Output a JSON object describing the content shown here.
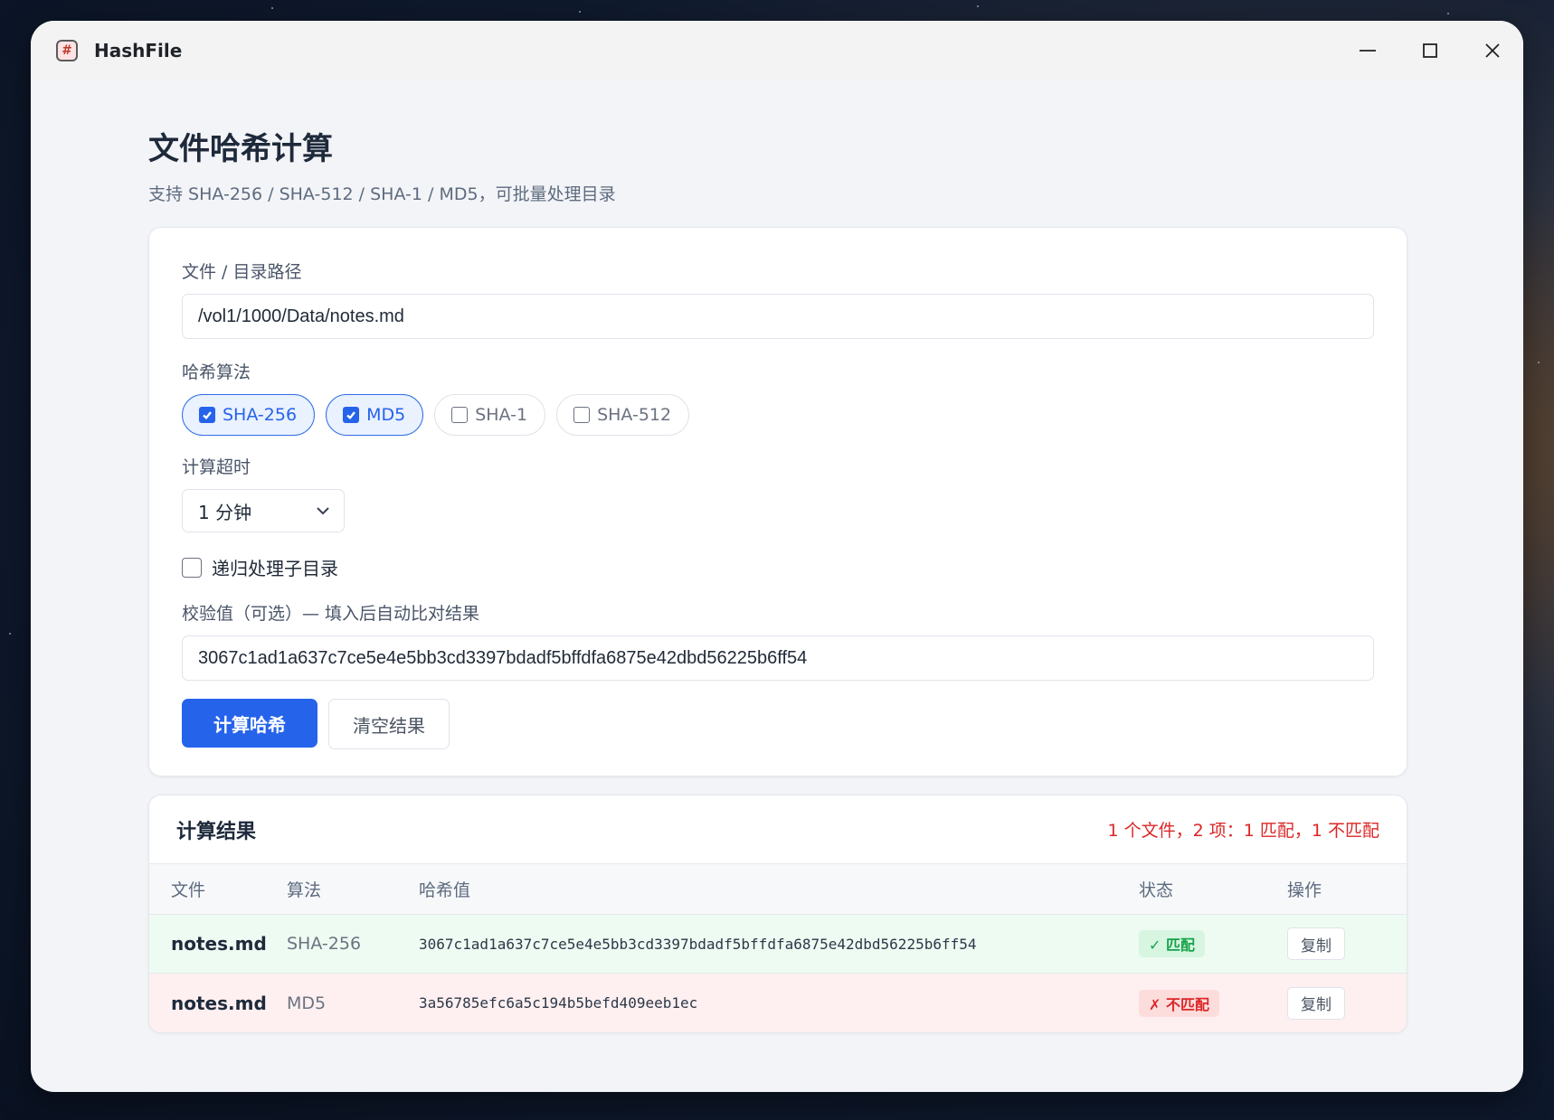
{
  "window": {
    "title": "HashFile",
    "icon": "hash-grid-icon"
  },
  "header": {
    "title": "文件哈希计算",
    "subtitle": "支持 SHA-256 / SHA-512 / SHA-1 / MD5，可批量处理目录"
  },
  "form": {
    "path_label": "文件 / 目录路径",
    "path_value": "/vol1/1000/Data/notes.md",
    "algo_label": "哈希算法",
    "algorithms": [
      {
        "label": "SHA-256",
        "checked": true
      },
      {
        "label": "MD5",
        "checked": true
      },
      {
        "label": "SHA-1",
        "checked": false
      },
      {
        "label": "SHA-512",
        "checked": false
      }
    ],
    "timeout_label": "计算超时",
    "timeout_value": "1 分钟",
    "recurse_label": "递归处理子目录",
    "recurse_checked": false,
    "checksum_label": "校验值（可选）— 填入后自动比对结果",
    "checksum_value": "3067c1ad1a637c7ce5e4e5bb3cd3397bdadf5bffdfa6875e42dbd56225b6ff54",
    "compute_label": "计算哈希",
    "clear_label": "清空结果"
  },
  "results": {
    "title": "计算结果",
    "summary": "1 个文件，2 项：1 匹配，1 不匹配",
    "columns": [
      "文件",
      "算法",
      "哈希值",
      "状态",
      "操作"
    ],
    "rows": [
      {
        "file": "notes.md",
        "algo": "SHA-256",
        "hash": "3067c1ad1a637c7ce5e4e5bb3cd3397bdadf5bffdfa6875e42dbd56225b6ff54",
        "status": "✓ 匹配",
        "action": "复制"
      },
      {
        "file": "notes.md",
        "algo": "MD5",
        "hash": "3a56785efc6a5c194b5befd409eeb1ec",
        "status": "✗ 不匹配",
        "action": "复制"
      }
    ]
  },
  "colors": {
    "accent": "#2563eb",
    "match_bg": "#eefbf2",
    "mismatch_bg": "#fef0f0",
    "error_text": "#dc2626",
    "success_text": "#16a34a"
  }
}
